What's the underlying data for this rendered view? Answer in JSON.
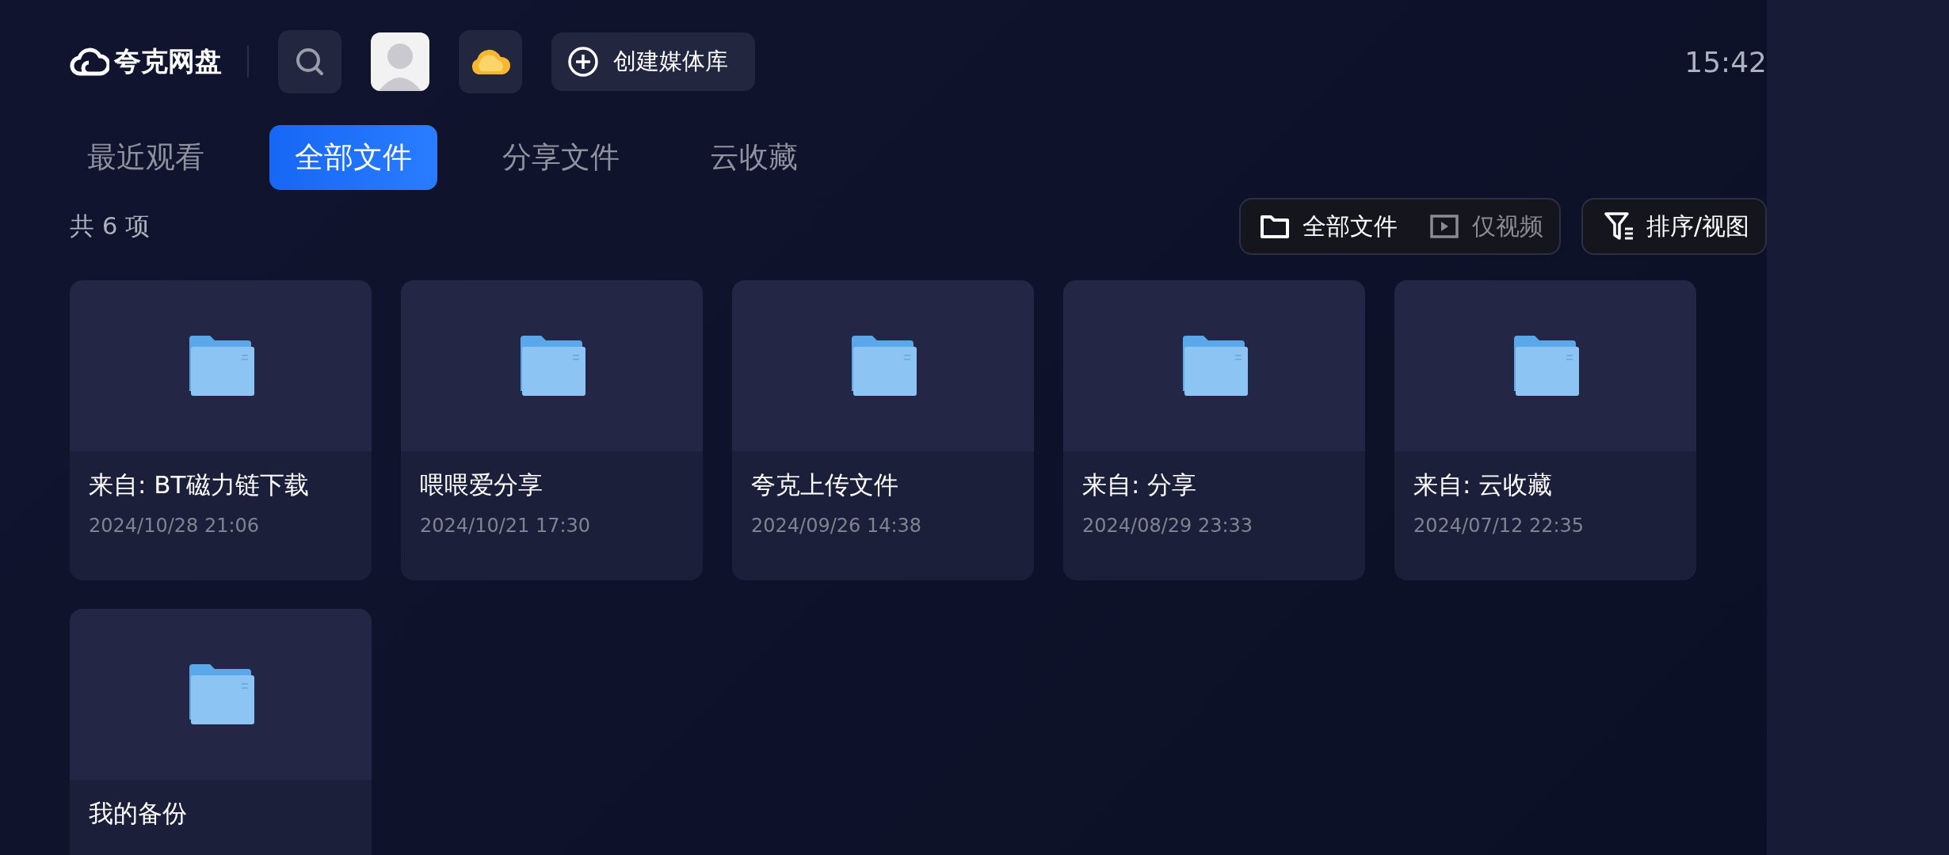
{
  "header": {
    "logo": "夸克网盘",
    "create_button": "创建媒体库",
    "time": "15:42"
  },
  "tabs": [
    {
      "label": "最近观看",
      "selected": false
    },
    {
      "label": "全部文件",
      "selected": true
    },
    {
      "label": "分享文件",
      "selected": false
    },
    {
      "label": "云收藏",
      "selected": false
    }
  ],
  "count": "共 6 项",
  "filter": [
    {
      "label": "全部文件",
      "kind": "folder",
      "selected": true
    },
    {
      "label": "仅视频",
      "kind": "video",
      "selected": false
    }
  ],
  "sort_button": "排序/视图",
  "files": [
    {
      "name": "来自: BT磁力链下载",
      "date": "2024/10/28 21:06"
    },
    {
      "name": "喂喂爱分享",
      "date": "2024/10/21 17:30"
    },
    {
      "name": "夸克上传文件",
      "date": "2024/09/26 14:38"
    },
    {
      "name": "来自: 分享",
      "date": "2024/08/29 23:33"
    },
    {
      "name": "来自: 云收藏",
      "date": "2024/07/12 22:35"
    },
    {
      "name": "我的备份"
    }
  ]
}
